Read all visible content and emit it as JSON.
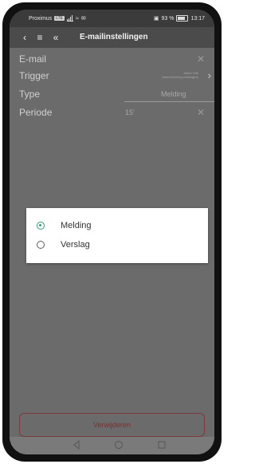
{
  "status_bar": {
    "carrier": "Proximus",
    "carrier_badge": "LTE",
    "battery": "93 %",
    "time": "13:17"
  },
  "toolbar": {
    "back_icon": "back-arrow-icon",
    "menu_icon": "hamburger-icon",
    "double_back_icon": "double-chevron-left-icon",
    "title": "E-mailinstellingen"
  },
  "form": {
    "email": {
      "label": "E-mail",
      "clear_icon": "✕"
    },
    "trigger": {
      "label": "Trigger",
      "value_line1": "Alarm Vdb",
      "value_line2": "alarmOpening,Closing(m)"
    },
    "type": {
      "label": "Type",
      "value": "Melding"
    },
    "periode": {
      "label": "Periode",
      "value": "15'",
      "clear_icon": "✕"
    }
  },
  "dialog": {
    "options": [
      {
        "label": "Melding",
        "selected": true
      },
      {
        "label": "Verslag",
        "selected": false
      }
    ]
  },
  "delete_button": {
    "label": "Verwijderen"
  },
  "colors": {
    "accent": "#2aa06a",
    "delete": "#7d3a3a",
    "overlay": "#6b6b6b"
  },
  "nav": {
    "back": "triangle-back-icon",
    "home": "circle-home-icon",
    "recent": "square-recent-icon"
  }
}
